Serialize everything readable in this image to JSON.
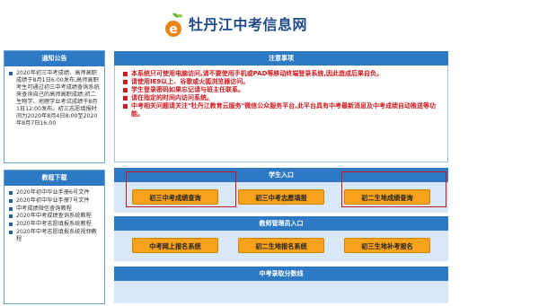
{
  "site": {
    "title": "牡丹江中考信息网",
    "logo_letter": "e"
  },
  "sidebar": {
    "notice": {
      "title": "通知公告",
      "items": [
        "2020年初三中考成绩、高师高职成绩于8月1日6:00发布,高师高职考生可通过初三中考成绩查询系统来查询自己的高师高职成绩;初二生物学、地理学业考试成绩于8月1日12:00发布。初三志愿填报时间为2020年8月4日8:00至2020年8月7日16:00"
      ]
    },
    "downloads": {
      "title": "教程下载",
      "items": [
        "2020年初中毕业手册6号文件",
        "2020年初中毕业手册7号文件",
        "中考成绩微信查询教程",
        "2020年中考成绩查询系统教程",
        "2020年中考志愿填报系统教程",
        "2020年中考志愿填报系统视频教程"
      ]
    }
  },
  "notice_section": {
    "title": "注意事项",
    "items": [
      "本系统只可使用电脑访问,请不要使用手机或PAD等移动终端登录系统,因此造成后果自负。",
      "请使用IE9以上、谷歌或火狐浏览器访问。",
      "学生登录密码如果忘记请与班主任联系。",
      "请在指定的时间内访问系统。",
      "中考相关问题请关注\"牡丹江教育云服务\"微信公众服务平台,此平台具有中考最新消息及中考成绩自动推送等功能。"
    ]
  },
  "student_section": {
    "title": "学生入口",
    "buttons": [
      "初三中考成绩查询",
      "初三中考志愿填报",
      "初二生地成绩查询"
    ]
  },
  "teacher_section": {
    "title": "教师管理员入口",
    "buttons": [
      "中考网上报名系统",
      "初二生地报名系统",
      "初三生地补考报名"
    ]
  },
  "score_section": {
    "title": "中考录取分数线"
  },
  "colors": {
    "accent": "#2e79c4",
    "button": "#f7a21a",
    "warning": "#d0181e",
    "highlight": "#c9141b"
  }
}
